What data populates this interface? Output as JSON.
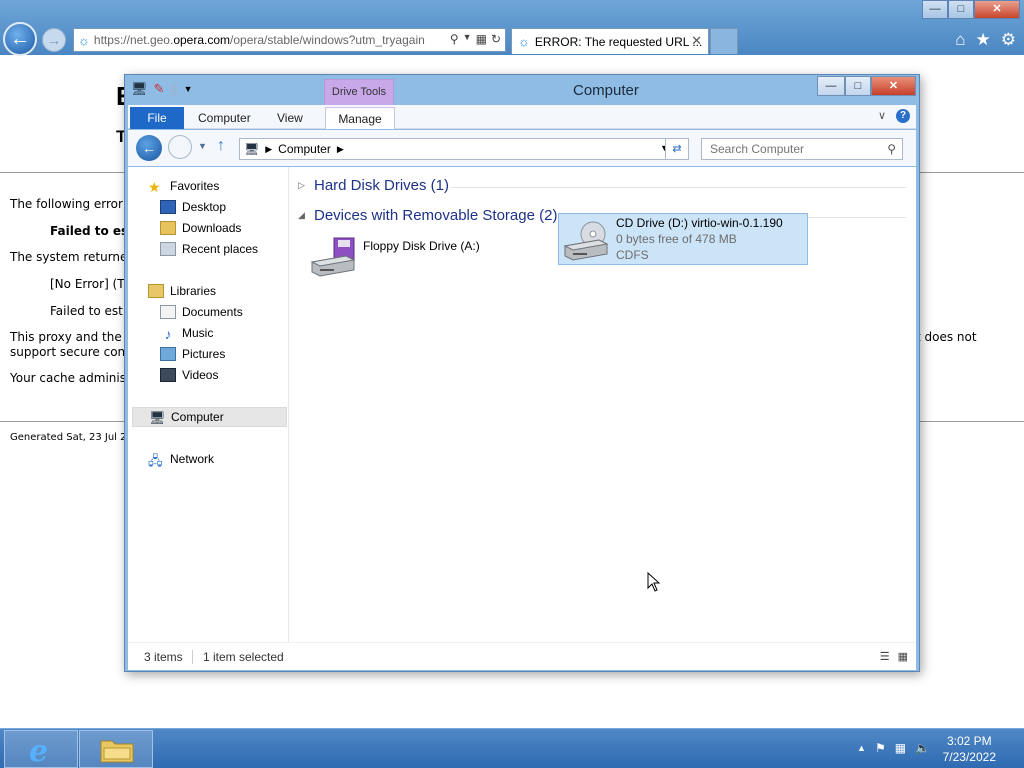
{
  "ie": {
    "address_pre": "https://net.geo.",
    "address_host": "opera.com",
    "address_post": "/opera/stable/windows?utm_tryagain",
    "tab_title": "ERROR: The requested URL ...",
    "page": {
      "heading_char": "E",
      "subheading_char": "T",
      "line1": "The following error",
      "line2": "Failed to est",
      "line3": "The system returne",
      "line4": "[No Error] (T",
      "line5": "Failed to est",
      "line6a": "This proxy and the",
      "line6b": "support secure con",
      "line6c": "t does not",
      "line7": "Your cache adminis",
      "footer": "Generated Sat, 23 Jul 20"
    }
  },
  "explorer": {
    "title": "Computer",
    "context_tab": "Drive Tools",
    "ribbon_tabs": {
      "file": "File",
      "computer": "Computer",
      "view": "View",
      "manage": "Manage"
    },
    "breadcrumb": "Computer",
    "search_placeholder": "Search Computer",
    "nav": {
      "favorites": "Favorites",
      "desktop": "Desktop",
      "downloads": "Downloads",
      "recent": "Recent places",
      "libraries": "Libraries",
      "documents": "Documents",
      "music": "Music",
      "pictures": "Pictures",
      "videos": "Videos",
      "computer": "Computer",
      "network": "Network"
    },
    "groups": {
      "hdd": "Hard Disk Drives (1)",
      "removable": "Devices with Removable Storage (2)"
    },
    "items": {
      "floppy": "Floppy Disk Drive (A:)",
      "cd_name": "CD Drive (D:) virtio-win-0.1.190",
      "cd_free": "0 bytes free of 478 MB",
      "cd_fs": "CDFS"
    },
    "status": {
      "count": "3 items",
      "selected": "1 item selected"
    }
  },
  "taskbar": {
    "time": "3:02 PM",
    "date": "7/23/2022"
  },
  "colors": {
    "ie_chrome": "#4a86c2",
    "file_tab": "#1e69c8",
    "drive_tools": "#c9a8e9",
    "selected_tile": "#cce4f7",
    "group_header": "#1e3287",
    "taskbar": "#2f6bb1"
  }
}
